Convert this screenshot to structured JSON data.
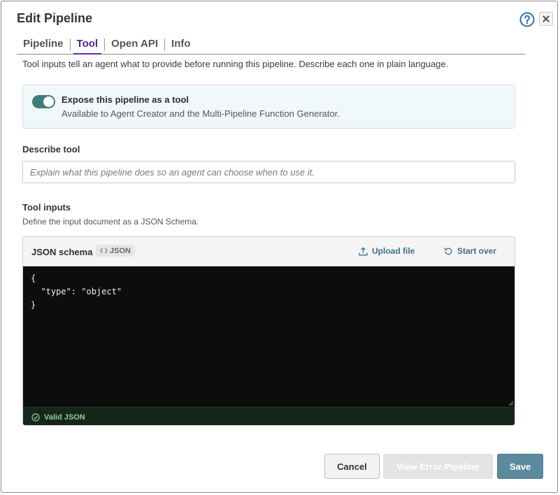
{
  "dialog": {
    "title": "Edit Pipeline",
    "help_icon": "question-circle-icon",
    "close_icon": "close-icon"
  },
  "tabs": [
    {
      "label": "Pipeline",
      "active": false
    },
    {
      "label": "Tool",
      "active": true
    },
    {
      "label": "Open API",
      "active": false
    },
    {
      "label": "Info",
      "active": false
    }
  ],
  "intro_text": "Tool inputs tell an agent what to provide before running this pipeline. Describe each one in plain language.",
  "expose": {
    "enabled": true,
    "title": "Expose this pipeline as a tool",
    "subtitle": "Available to Agent Creator and the Multi-Pipeline Function Generator."
  },
  "describe_tool": {
    "label": "Describe tool",
    "value": "",
    "placeholder": "Explain what this pipeline does so an agent can choose when to use it."
  },
  "tool_inputs": {
    "label": "Tool inputs",
    "sublabel": "Define the input document as a JSON Schema."
  },
  "editor": {
    "title": "JSON schema",
    "badge": "JSON",
    "badge_icon": "code-icon",
    "upload_label": "Upload file",
    "upload_icon": "upload-icon",
    "start_over_label": "Start over",
    "start_over_icon": "undo-icon",
    "code_lines": [
      "{",
      "  \"type\": \"object\"",
      "}"
    ],
    "status_icon": "check-circle-icon",
    "status": "Valid JSON"
  },
  "footer": {
    "cancel_label": "Cancel",
    "view_error_label": "View Error Pipeline",
    "save_label": "Save"
  },
  "colors": {
    "accent_tab": "#5a1e8c",
    "toggle_on": "#3d7d7a",
    "link": "#3f6f8e",
    "save_button": "#5b8a9c",
    "valid_status": "#8cd48f"
  }
}
